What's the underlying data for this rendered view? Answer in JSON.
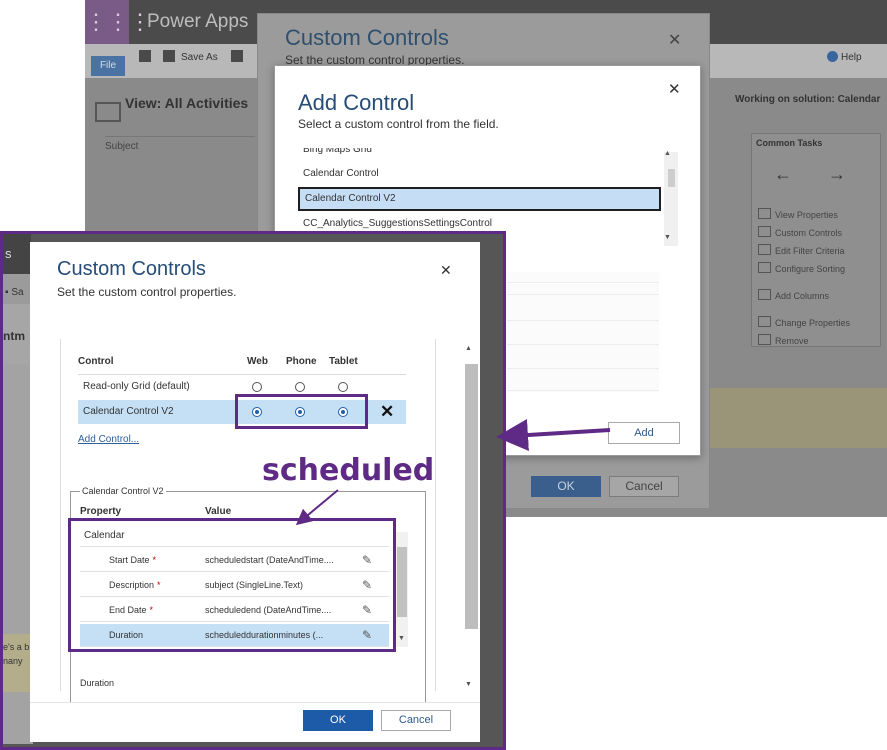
{
  "background_app": {
    "app_name": "Power Apps",
    "file_tab": "File",
    "save_as": "Save As",
    "help": "Help",
    "view_title": "View: All Activities",
    "subject_column": "Subject",
    "solution_label": "Working on solution: Calendar",
    "common_tasks": {
      "title": "Common Tasks",
      "items": [
        "View Properties",
        "Custom Controls",
        "Edit Filter Criteria",
        "Configure Sorting",
        "Add Columns",
        "Change Properties",
        "Remove"
      ]
    }
  },
  "background_dialog": {
    "title": "Custom Controls",
    "subtitle": "Set the custom control properties.",
    "ok": "OK",
    "cancel": "Cancel"
  },
  "add_control_dialog": {
    "title": "Add Control",
    "subtitle": "Select a custom control from the field.",
    "items": [
      "Bing Maps Grid",
      "Calendar Control",
      "Calendar Control V2",
      "CC_Analytics_SuggestionsSettingsControl"
    ],
    "selected": "Calendar Control V2",
    "add_button": "Add"
  },
  "custom_controls_dialog": {
    "title": "Custom Controls",
    "subtitle": "Set the custom control properties.",
    "columns": {
      "control": "Control",
      "web": "Web",
      "phone": "Phone",
      "tablet": "Tablet"
    },
    "controls": [
      {
        "name": "Read-only Grid (default)",
        "web": false,
        "phone": false,
        "tablet": false
      },
      {
        "name": "Calendar Control V2",
        "web": true,
        "phone": true,
        "tablet": true
      }
    ],
    "add_control_link": "Add Control...",
    "group_label": "Calendar Control V2",
    "prop_columns": {
      "property": "Property",
      "value": "Value"
    },
    "group_name": "Calendar",
    "properties": [
      {
        "name": "Start Date",
        "required": "*",
        "value": "scheduledstart (DateAndTime...."
      },
      {
        "name": "Description",
        "required": "*",
        "value": "subject (SingleLine.Text)"
      },
      {
        "name": "End Date",
        "required": "*",
        "value": "scheduledend (DateAndTime...."
      },
      {
        "name": "Duration",
        "required": "",
        "value": "scheduleddurationminutes (..."
      }
    ],
    "footer_label": "Duration",
    "ok": "OK",
    "cancel": "Cancel"
  },
  "annotation": {
    "text": "scheduled",
    "color": "#5e2a85"
  },
  "colors": {
    "accent_blue": "#1d5aa8",
    "selection": "#c5dff5",
    "highlight_border": "#5e2a85"
  }
}
